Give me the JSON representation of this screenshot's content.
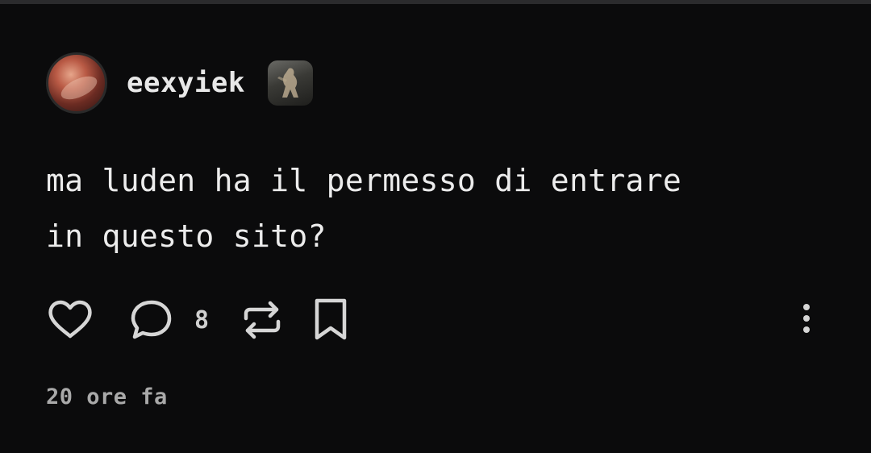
{
  "post": {
    "author": {
      "username": "eexyiek"
    },
    "text_lines": [
      "ma luden ha il permesso di entrare",
      "in questo sito?"
    ],
    "actions": {
      "comment_count": "8"
    },
    "timestamp": "20 ore fa"
  },
  "icons": {
    "like": "heart-icon",
    "comment": "comment-bubble-icon",
    "repost": "repost-icon",
    "bookmark": "bookmark-icon",
    "more": "more-vertical-icon"
  },
  "colors": {
    "background": "#0b0b0c",
    "text": "#ececec",
    "icon": "#d6d6d6",
    "muted": "#a9a9a9"
  }
}
